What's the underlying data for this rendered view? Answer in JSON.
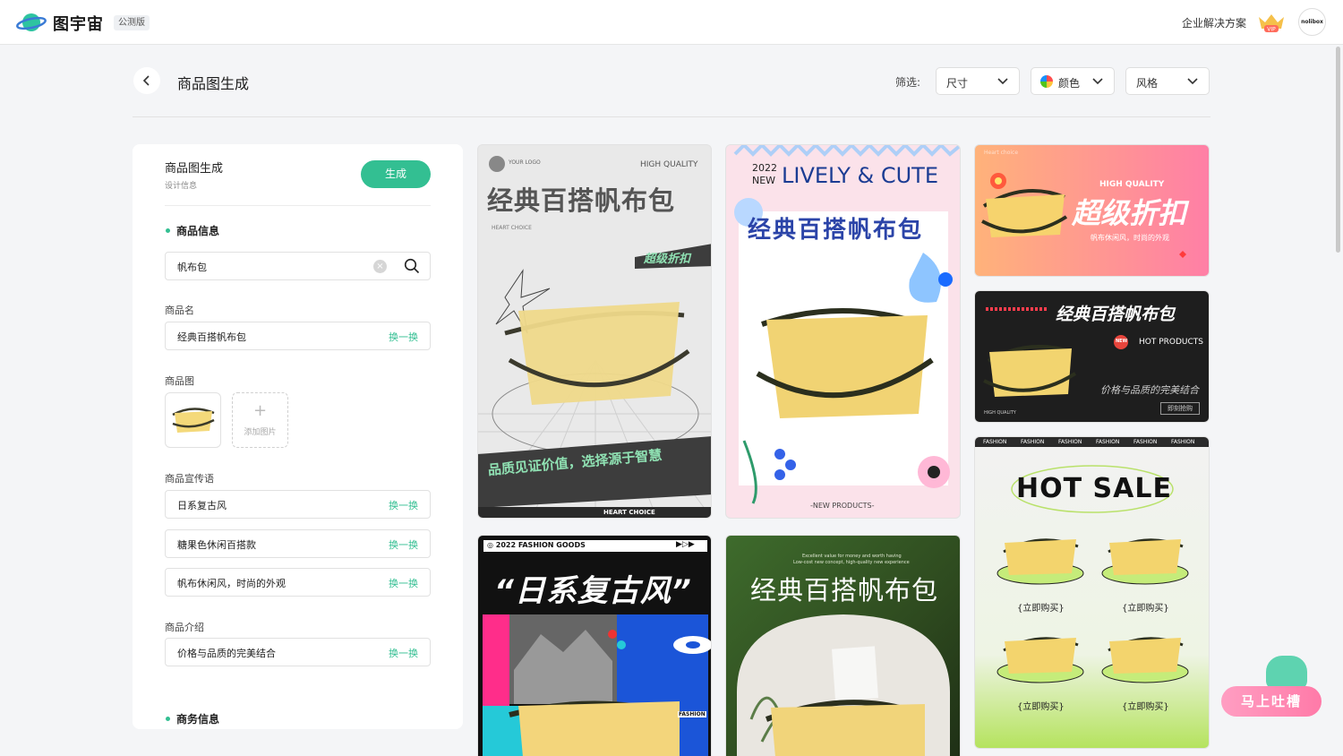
{
  "app": {
    "name": "图宇宙",
    "badge": "公测版"
  },
  "topbar": {
    "enterprise_link": "企业解决方案",
    "vip_label": "VIP",
    "avatar_text": "nolibox"
  },
  "header": {
    "title": "商品图生成",
    "filter_label": "筛选:",
    "filters": [
      {
        "label": "尺寸"
      },
      {
        "label": "颜色"
      },
      {
        "label": "风格"
      }
    ]
  },
  "panel": {
    "title": "商品图生成",
    "subtitle": "设计信息",
    "generate_button": "生成",
    "section_product": "商品信息",
    "search_value": "帆布包",
    "name_label": "商品名",
    "name_value": "经典百搭帆布包",
    "swap_label": "换一换",
    "image_label": "商品图",
    "add_image": "添加图片",
    "slogan_label": "商品宣传语",
    "slogans": [
      "日系复古风",
      "糖果色休闲百搭款",
      "帆布休闲风，时尚的外观"
    ],
    "intro_label": "商品介绍",
    "intro_value": "价格与品质的完美结合",
    "section_business": "商务信息"
  },
  "results": {
    "card1": {
      "logo": "YOUR LOGO",
      "tag": "HIGH QUALITY",
      "title": "经典百搭帆布包",
      "sub": "HEART CHOICE",
      "ribbon": "超级折扣",
      "banner": "品质见证价值，选择源于智慧",
      "footer": "HEART CHOICE"
    },
    "card2": {
      "year": "2022",
      "new": "NEW",
      "headline": "LIVELY & CUTE",
      "title": "经典百搭帆布包",
      "footer": "-NEW PRODUCTS-"
    },
    "card3": {
      "tag": "HIGH QUALITY",
      "title": "超级折扣",
      "sub": "帆布休闲风，时尚的外观",
      "pattern": "Heart choice"
    },
    "card4": {
      "title": "经典百搭帆布包",
      "hot": "HOT PRODUCTS",
      "desc": "价格与品质的完美结合",
      "quality": "HIGH QUALITY",
      "button": "即刻抢购",
      "badge": "NEW"
    },
    "card5": {
      "ticker": "FASHION",
      "title": "HOT SALE",
      "buy": "{立即购买}"
    },
    "card6": {
      "header": "◎ 2022 FASHION GOODS",
      "title": "“日系复古风”",
      "fashion": "FASHION"
    },
    "card7": {
      "title": "经典百搭帆布包",
      "tagline": "Excellent value for money and worth having",
      "tagline2": "Low-cost new concept, high-quality new experience"
    }
  },
  "feedback": {
    "label": "马上吐槽"
  }
}
